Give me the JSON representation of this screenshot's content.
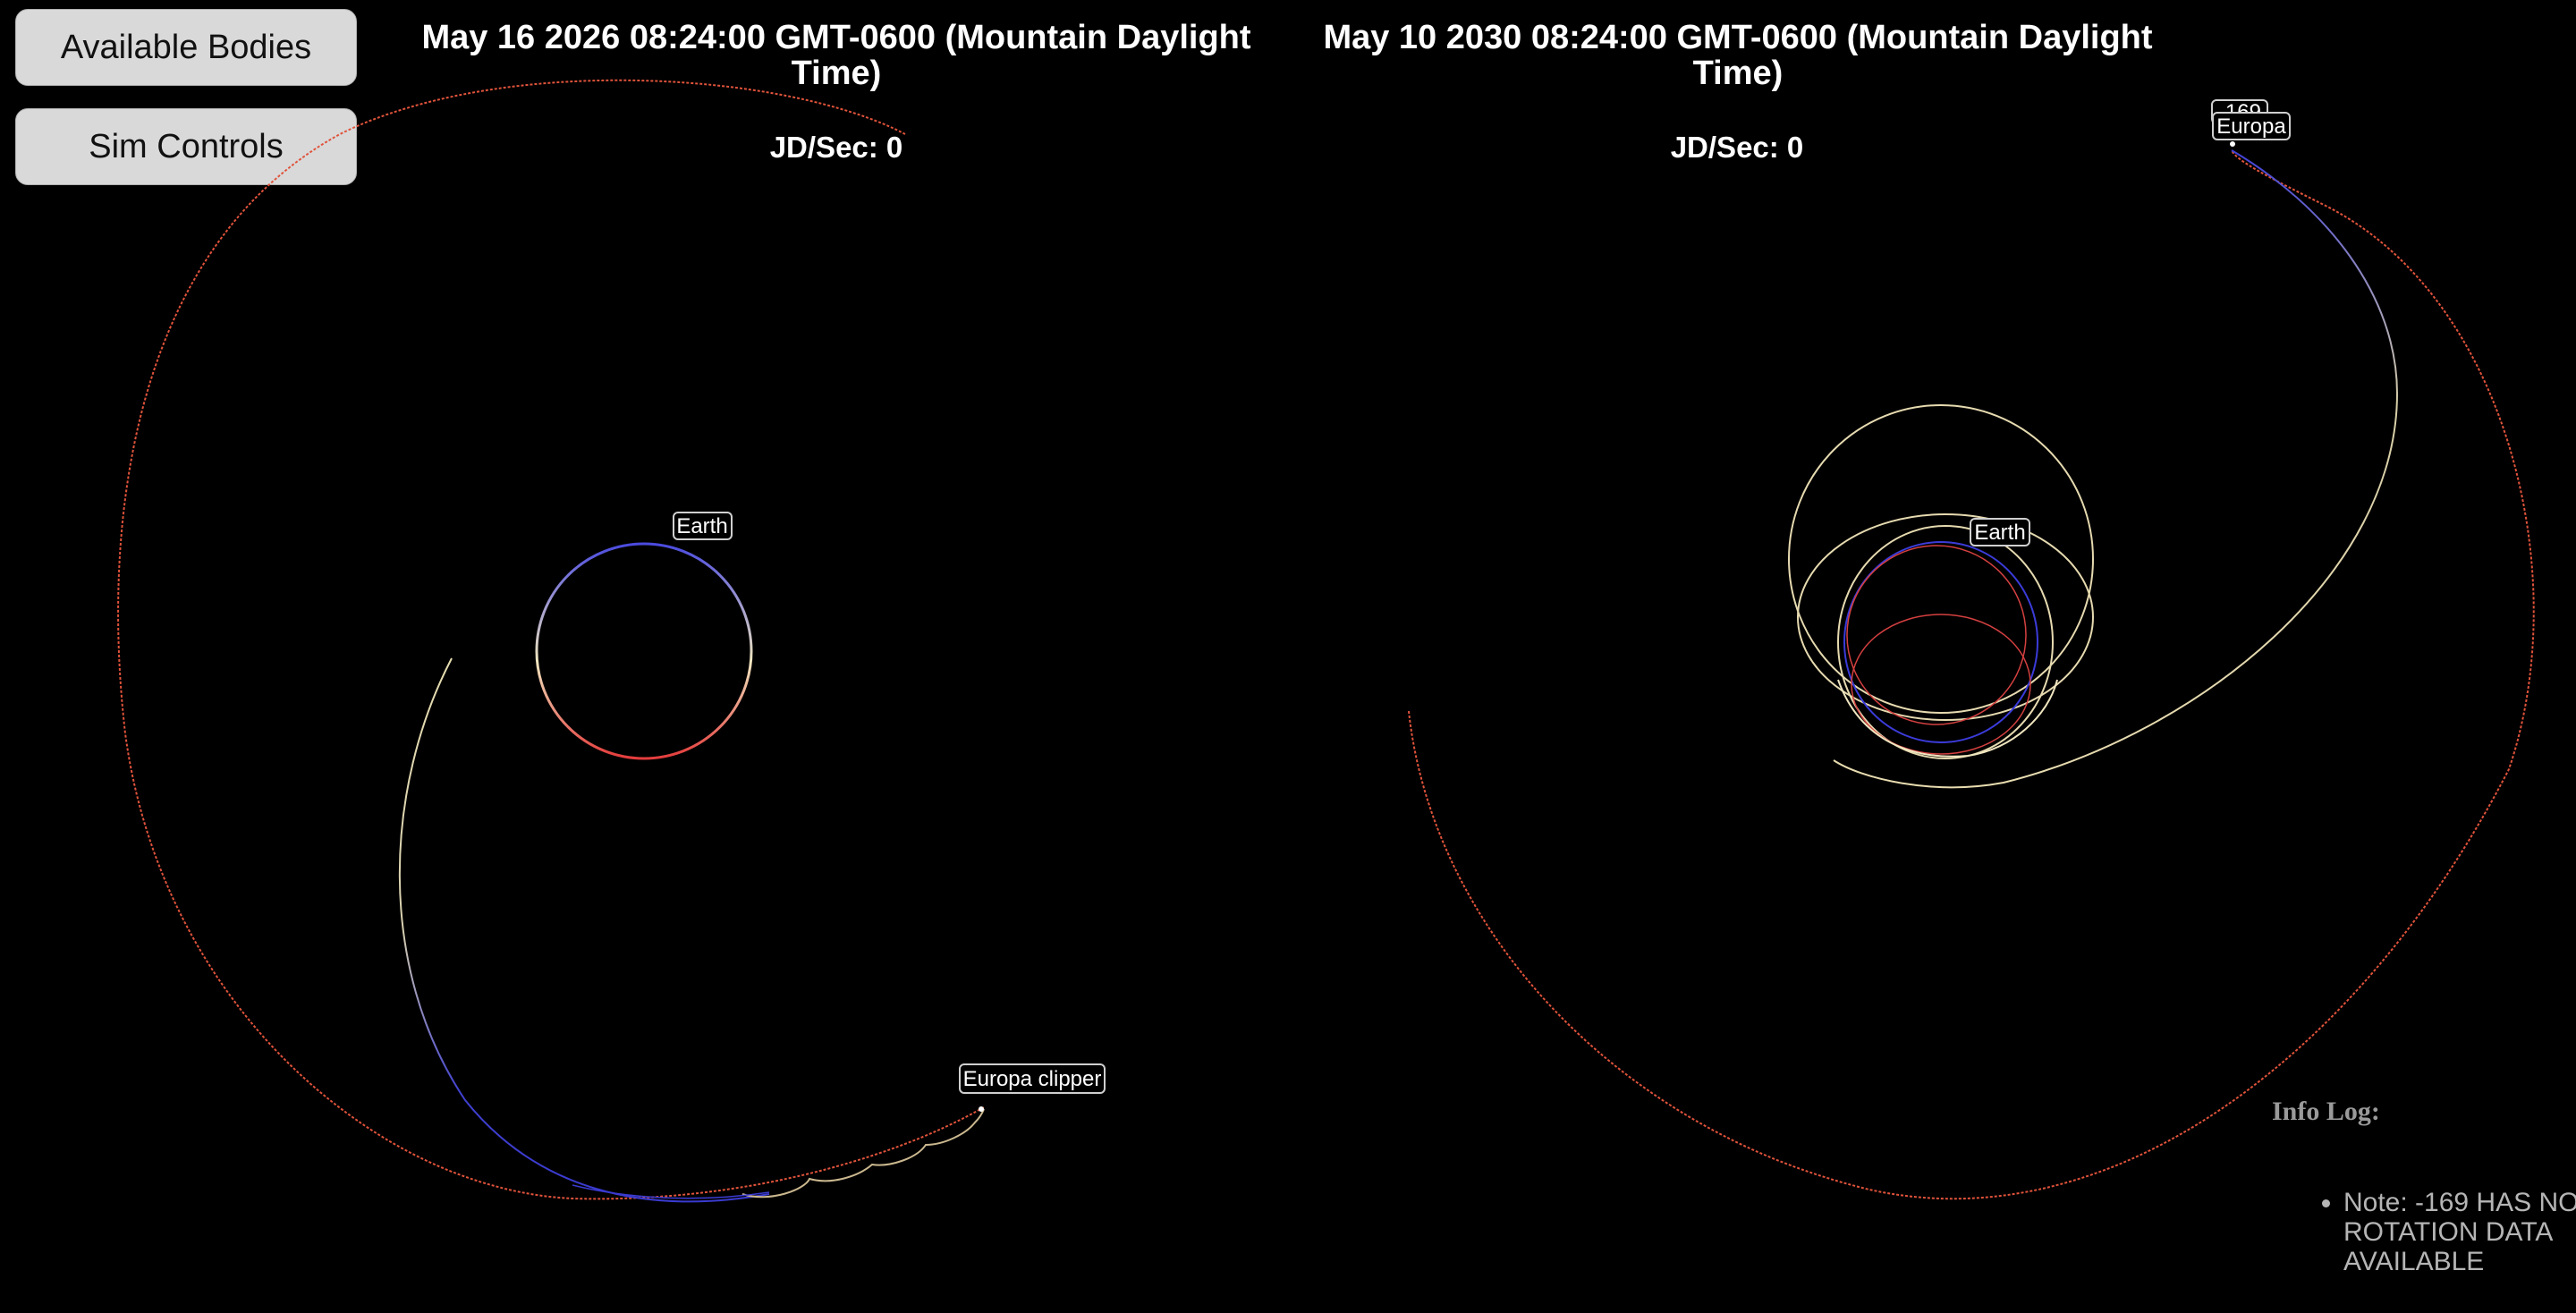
{
  "buttons": {
    "available_bodies": "Available Bodies",
    "sim_controls": "Sim Controls"
  },
  "left_view": {
    "date": "May 16 2026 08:24:00 GMT-0600 (Mountain Daylight Time)",
    "rate": "JD/Sec: 0",
    "labels": {
      "earth": "Earth",
      "spacecraft": "Europa clipper"
    }
  },
  "right_view": {
    "date": "May 10 2030 08:24:00 GMT-0600 (Mountain Daylight Time)",
    "rate": "JD/Sec: 0",
    "labels": {
      "earth": "Earth",
      "europa": "Europa",
      "spacecraft_id": "-169"
    }
  },
  "info_log": {
    "title": "Info Log:",
    "entries": [
      "Note: -169 HAS NO ROTATION DATA AVAILABLE"
    ]
  },
  "colors": {
    "background": "#000000",
    "orbit_red": "#e0533b",
    "orbit_blue": "#3b3bd9",
    "orbit_cream": "#e8dcb0",
    "button": "#d9d9d9"
  }
}
